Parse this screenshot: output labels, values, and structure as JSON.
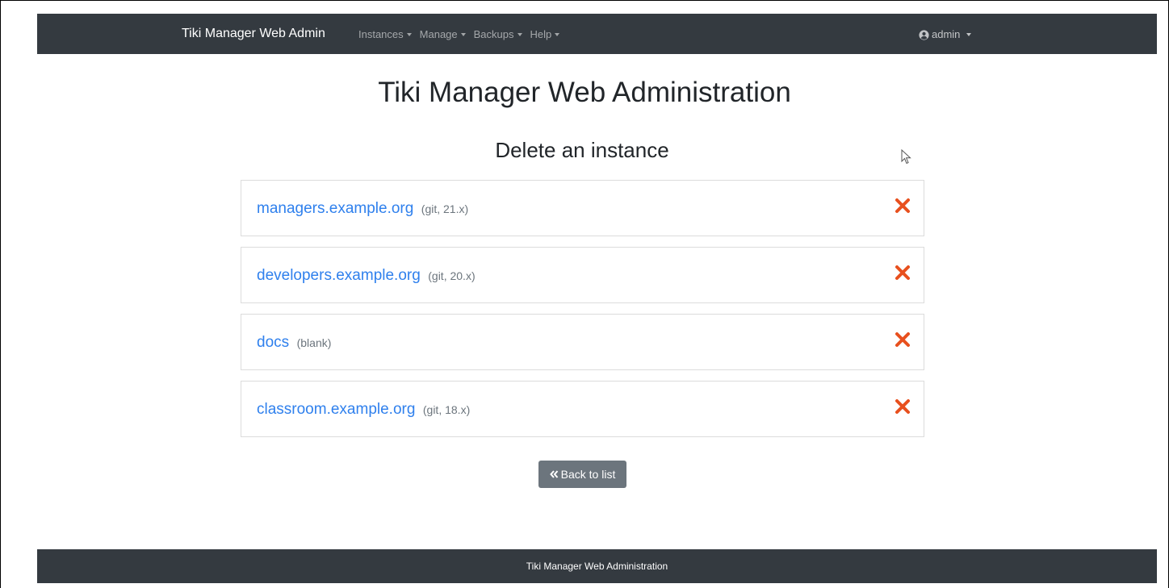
{
  "navbar": {
    "brand": "Tiki Manager Web Admin",
    "menus": [
      {
        "label": "Instances"
      },
      {
        "label": "Manage"
      },
      {
        "label": "Backups"
      },
      {
        "label": "Help"
      }
    ],
    "user": {
      "label": "admin",
      "icon": "user-circle-icon"
    }
  },
  "main": {
    "title": "Tiki Manager Web Administration",
    "subtitle": "Delete an instance",
    "instances": [
      {
        "name": "managers.example.org",
        "meta": "(git, 21.x)"
      },
      {
        "name": "developers.example.org",
        "meta": "(git, 20.x)"
      },
      {
        "name": "docs",
        "meta": "(blank)"
      },
      {
        "name": "classroom.example.org",
        "meta": "(git, 18.x)"
      }
    ],
    "back_button": "Back to list"
  },
  "footer": {
    "text": "Tiki Manager Web Administration"
  },
  "colors": {
    "navbar_bg": "#343a40",
    "link": "#2f80ed",
    "delete": "#e8501e",
    "button_bg": "#6c757d"
  }
}
